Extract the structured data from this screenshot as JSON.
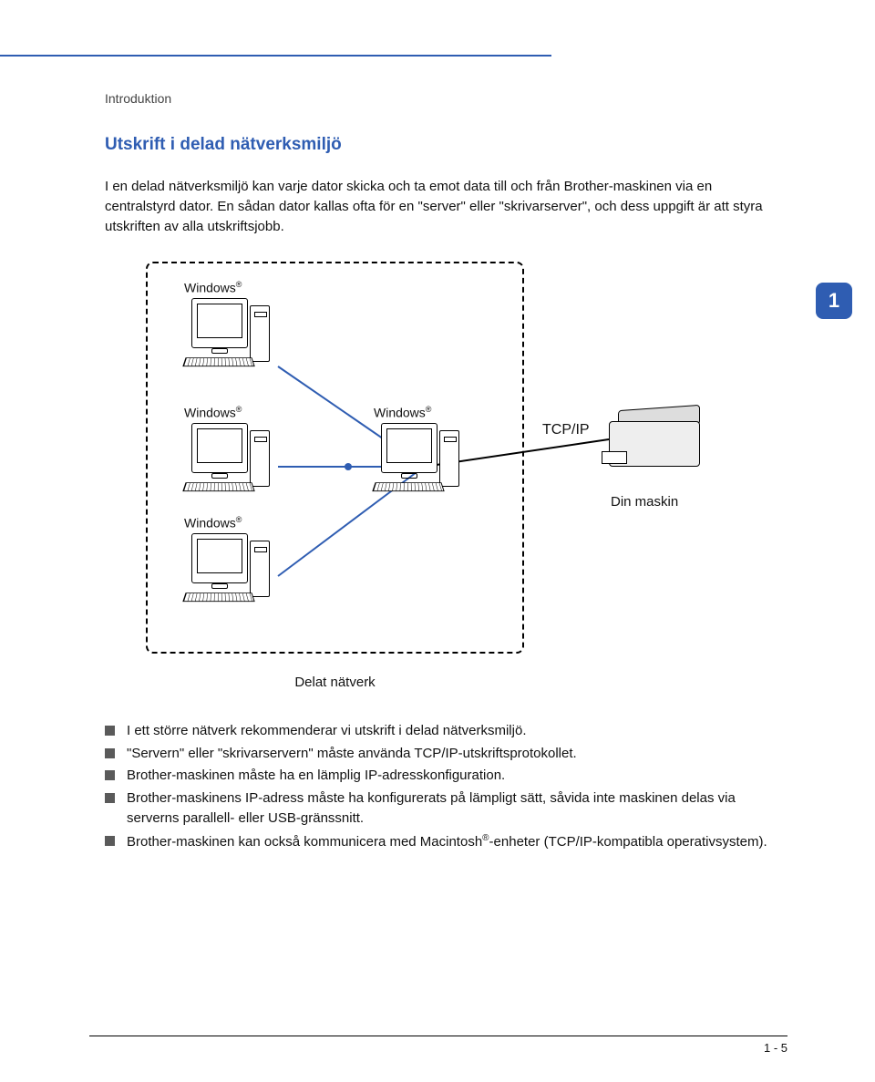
{
  "section": "Introduktion",
  "heading": "Utskrift i delad nätverksmiljö",
  "paragraph": "I en delad nätverksmiljö kan varje dator skicka och ta emot data till och från Brother-maskinen via en centralstyrd dator. En sådan dator kallas ofta för en \"server\" eller \"skrivarserver\", och dess uppgift är att styra utskriften av alla utskriftsjobb.",
  "tab": "1",
  "diagram": {
    "windows_label": "Windows",
    "registered": "®",
    "protocol": "TCP/IP",
    "machine": "Din maskin",
    "network_caption": "Delat nätverk"
  },
  "bullets": [
    "I ett större nätverk rekommenderar vi utskrift i delad nätverksmiljö.",
    "\"Servern\" eller \"skrivarservern\" måste använda TCP/IP-utskriftsprotokollet.",
    "Brother-maskinen måste ha en lämplig IP-adresskonfiguration.",
    "Brother-maskinens IP-adress måste ha konfigurerats på lämpligt sätt, såvida inte maskinen delas via serverns parallell- eller USB-gränssnitt.",
    "Brother-maskinen kan också kommunicera med Macintosh®-enheter (TCP/IP-kompatibla operativsystem)."
  ],
  "page_number": "1 - 5"
}
